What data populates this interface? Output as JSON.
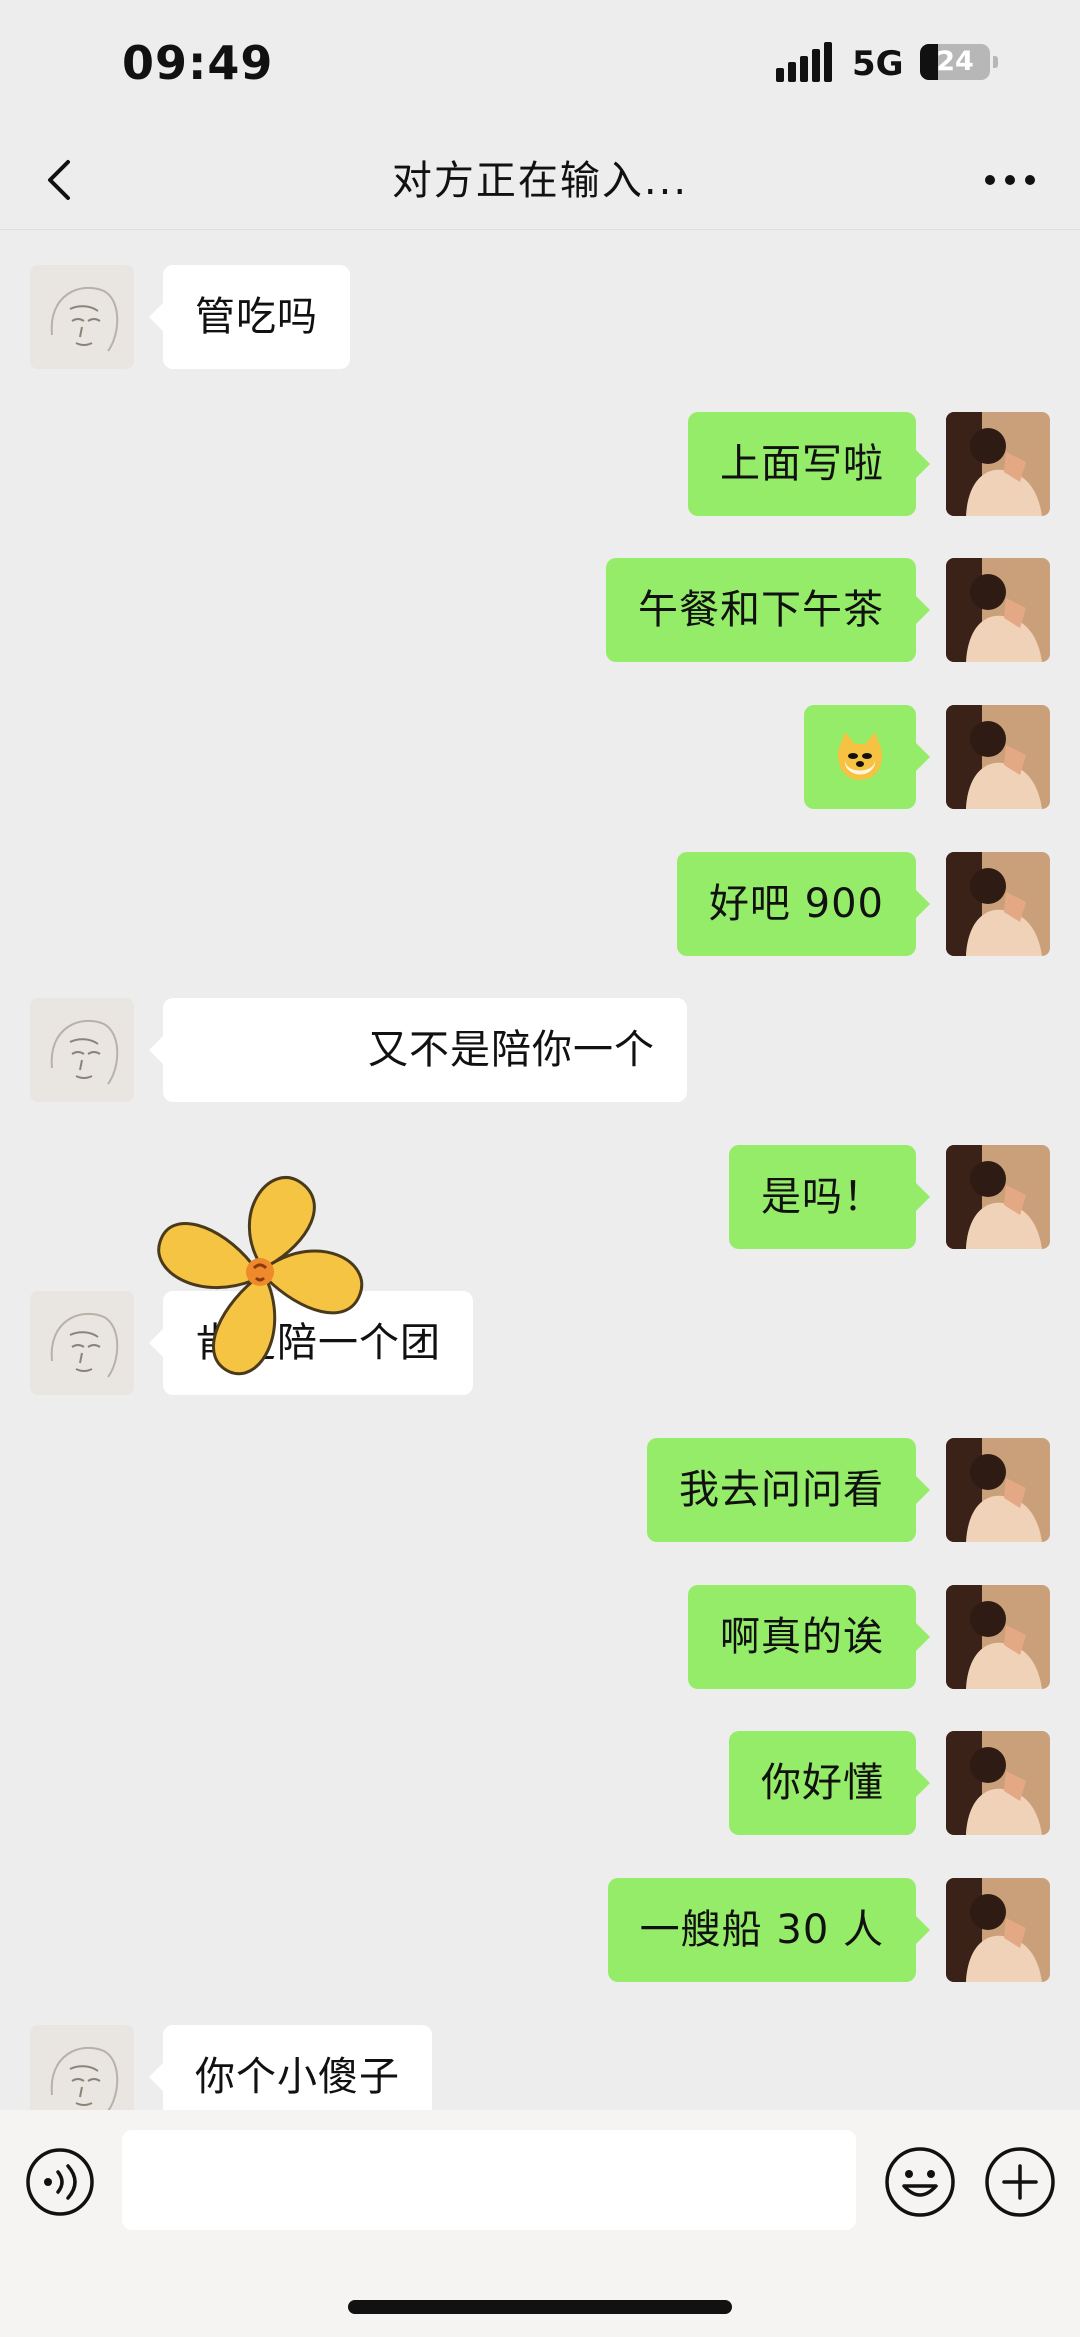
{
  "status_bar": {
    "time": "09:49",
    "network": "5G",
    "battery": "24"
  },
  "header": {
    "title": "对方正在输入..."
  },
  "messages": [
    {
      "side": "left",
      "text": "管吃吗"
    },
    {
      "side": "right",
      "text": "上面写啦"
    },
    {
      "side": "right",
      "text": "午餐和下午茶"
    },
    {
      "side": "right",
      "text": "",
      "emoji": "doge-emoji"
    },
    {
      "side": "right",
      "text": "好吧 900"
    },
    {
      "side": "left",
      "text": "又不是陪你一个"
    },
    {
      "side": "right",
      "text": "是吗！"
    },
    {
      "side": "left",
      "text": "肯定陪一个团"
    },
    {
      "side": "right",
      "text": "我去问问看"
    },
    {
      "side": "right",
      "text": "啊真的诶"
    },
    {
      "side": "right",
      "text": "你好懂"
    },
    {
      "side": "right",
      "text": "一艘船 30 人"
    },
    {
      "side": "left",
      "text": "你个小傻子"
    }
  ],
  "input": {
    "value": "",
    "placeholder": ""
  },
  "icons": {
    "back": "chevron-left-icon",
    "more": "more-dots-icon",
    "voice": "voice-icon",
    "emoji": "emoji-icon",
    "plus": "plus-icon"
  },
  "colors": {
    "self_bubble": "#95ec69",
    "other_bubble": "#ffffff",
    "background": "#ededed"
  }
}
